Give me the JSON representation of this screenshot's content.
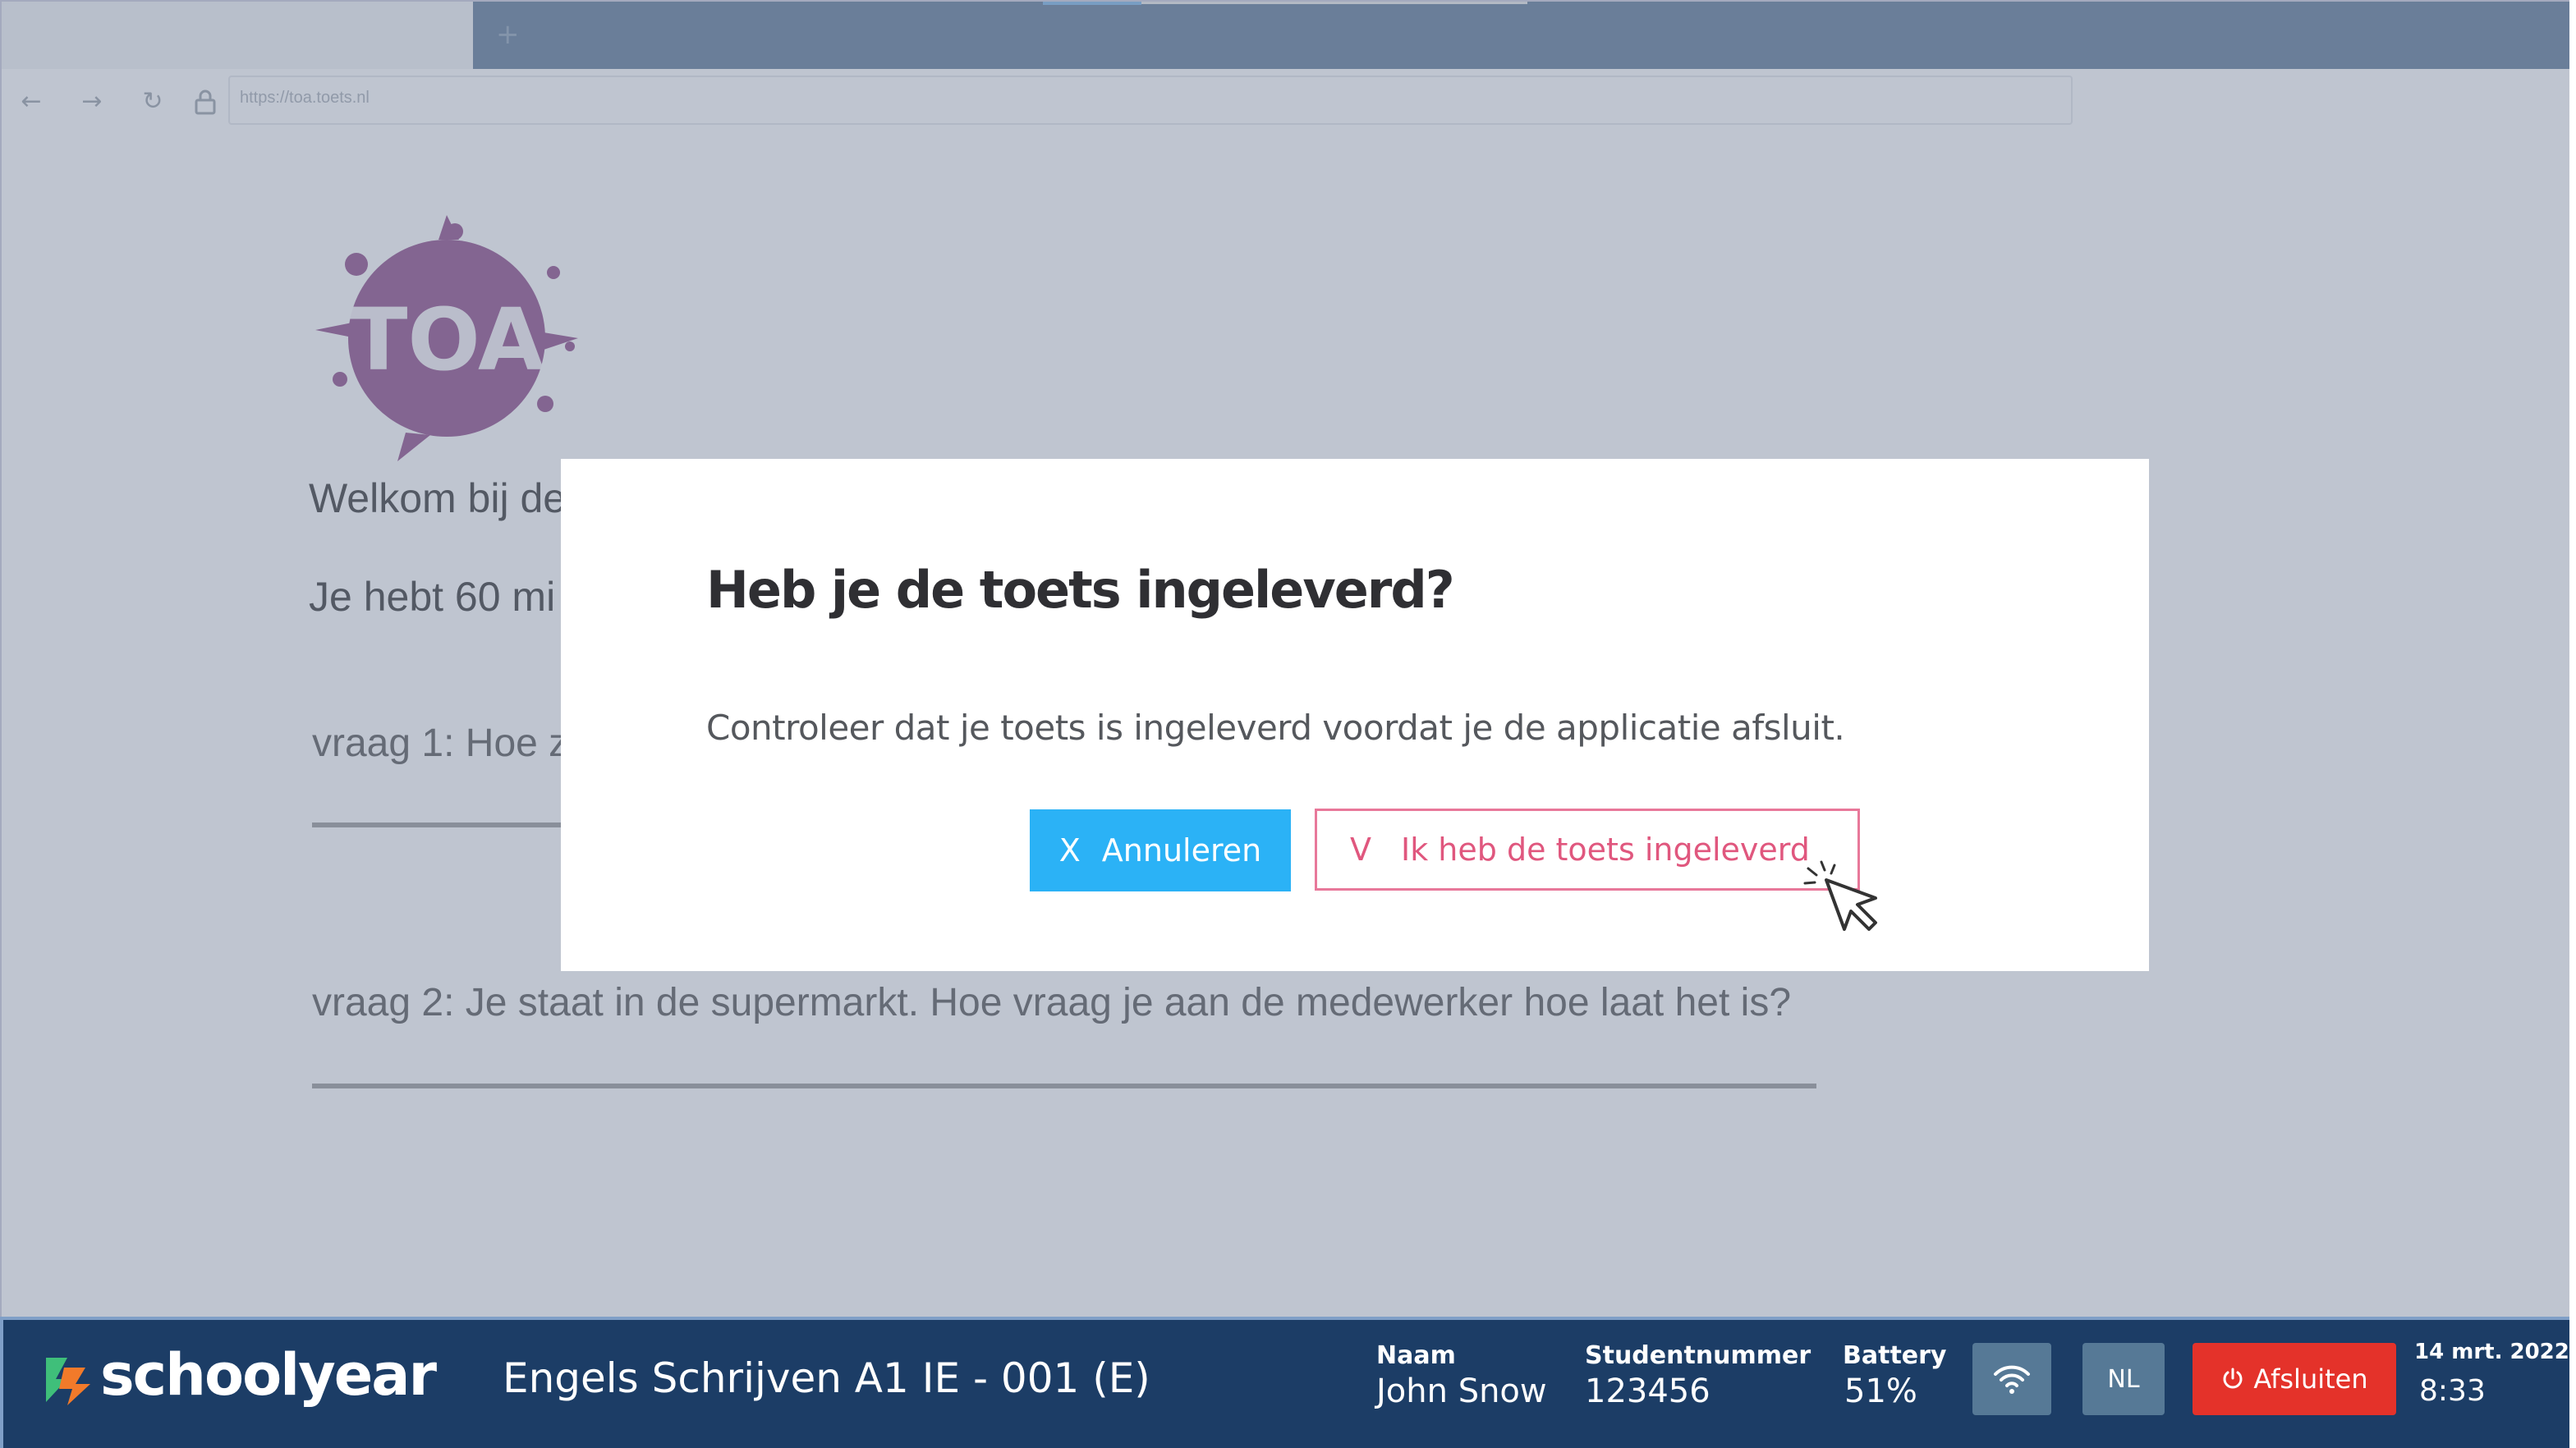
{
  "browser": {
    "new_tab_icon": "plus-icon",
    "back_icon": "arrow-left-icon",
    "forward_icon": "arrow-right-icon",
    "reload_icon": "refresh-icon",
    "lock_icon": "lock-icon",
    "url": "https://toa.toets.nl"
  },
  "page": {
    "logo_text": "TOA",
    "welcome_text": "Welkom bij de",
    "time_text": "Je hebt 60 mi",
    "question1": "vraag 1: Hoe z",
    "question2": "vraag 2: Je staat in de supermarkt. Hoe vraag je aan de medewerker hoe laat het is?"
  },
  "modal": {
    "title": "Heb je de toets ingeleverd?",
    "body": "Controleer dat je toets is ingeleverd voordat je de applicatie afsluit.",
    "cancel_prefix": "X",
    "cancel_label": "Annuleren",
    "confirm_prefix": "V",
    "confirm_label": "Ik heb de toets ingeleverd"
  },
  "bottombar": {
    "brand": "schoolyear",
    "exam_title": "Engels Schrijven A1 IE - 001 (E)",
    "name_label": "Naam",
    "name_value": "John Snow",
    "student_label": "Studentnummer",
    "student_value": "123456",
    "battery_label": "Battery",
    "battery_value": "51%",
    "language": "NL",
    "close_label": "Afsluiten",
    "date": "14 mrt. 2022",
    "time": "8:33"
  },
  "colors": {
    "brand_navy": "#1c3d66",
    "cancel_blue": "#2bb2f6",
    "confirm_pink": "#e0577e",
    "close_red": "#e4322a",
    "tab_blue": "#5f7a97"
  }
}
